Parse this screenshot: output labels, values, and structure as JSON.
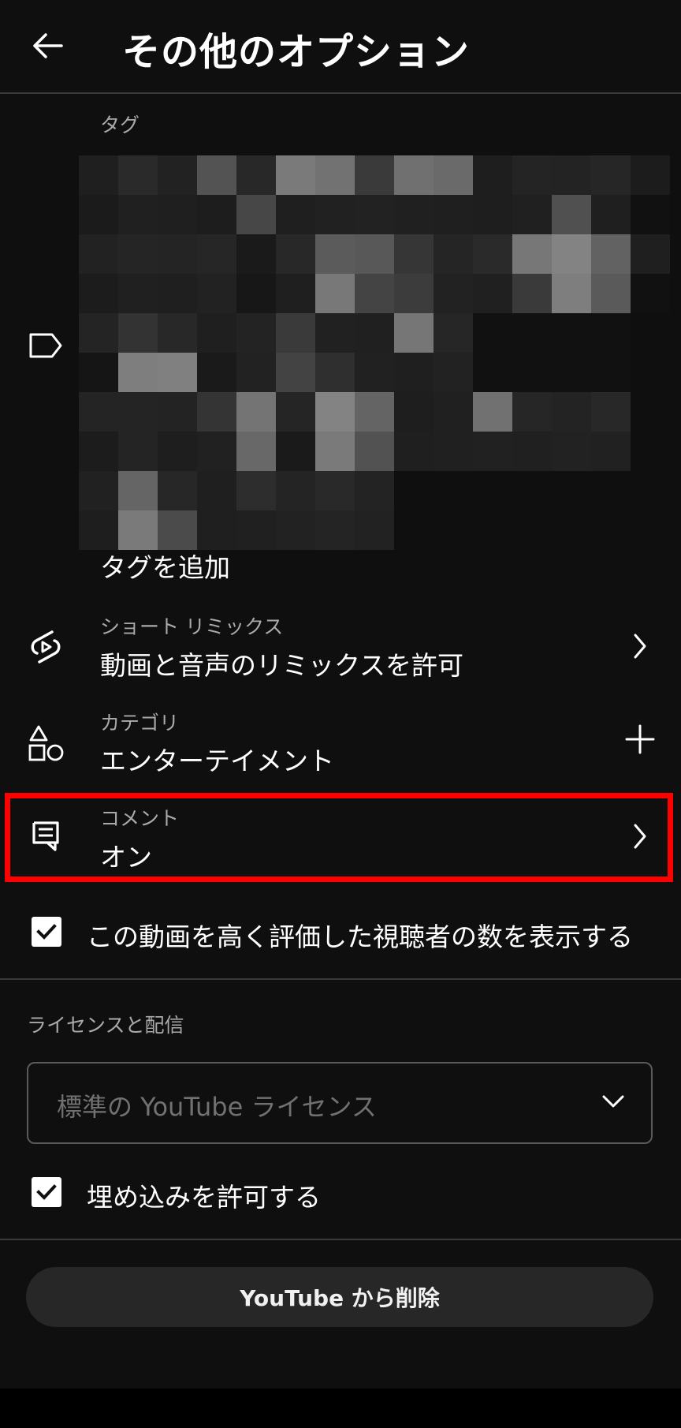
{
  "header": {
    "title": "その他のオプション",
    "back_icon": "arrow-left-icon"
  },
  "tags": {
    "label": "タグ",
    "add_label": "タグを追加",
    "icon": "tag-icon"
  },
  "remix": {
    "label": "ショート リミックス",
    "value": "動画と音声のリミックスを許可",
    "icon": "shorts-remix-icon"
  },
  "category": {
    "label": "カテゴリ",
    "value": "エンターテイメント",
    "icon": "shapes-icon"
  },
  "comments": {
    "label": "コメント",
    "value": "オン",
    "icon": "comment-icon",
    "highlight_color": "#ff0000"
  },
  "show_likes": {
    "label": "この動画を高く評価した視聴者の数を表示する",
    "checked": true
  },
  "license": {
    "section_label": "ライセンスと配信",
    "selected": "標準の YouTube ライセンス"
  },
  "embed": {
    "label": "埋め込みを許可する",
    "checked": true
  },
  "delete_button": {
    "label": "YouTube から削除"
  },
  "colors": {
    "background": "#0f0f0f",
    "text_primary": "#ffffff",
    "text_secondary": "#aaaaaa",
    "highlight": "#ff0000"
  }
}
